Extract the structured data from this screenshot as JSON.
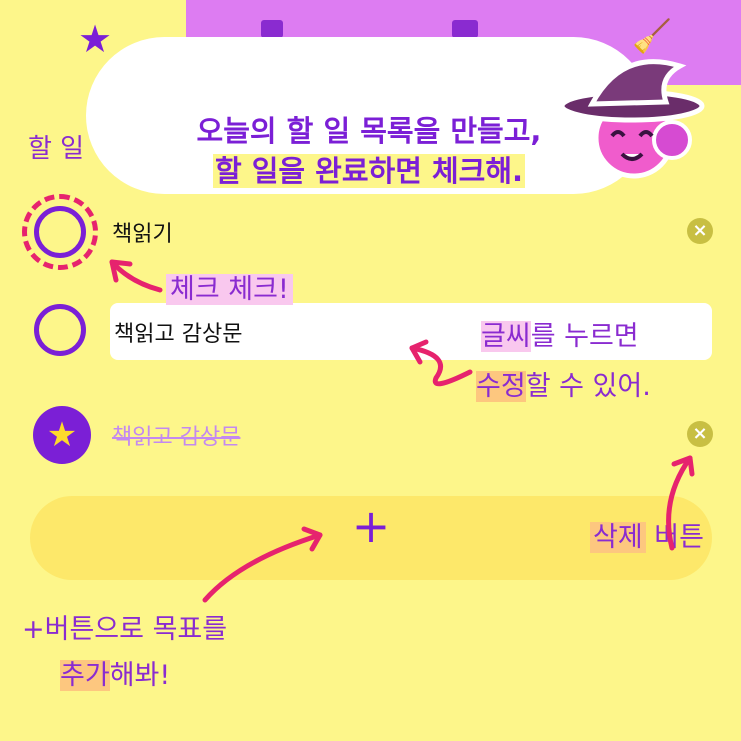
{
  "nav": {
    "icons": [
      "star-icon",
      "calendar-icon",
      "book-icon",
      "broom-icon"
    ],
    "colors": {
      "background": "#dd7cf2",
      "icon": "#8a2bd0"
    }
  },
  "header": {
    "title_partial": "할 일"
  },
  "bubble": {
    "line1": "오늘의 할 일 목록을 만들고,",
    "line2": "할 일을 완료하면 체크해."
  },
  "todos": [
    {
      "text": "책읽기",
      "done": false
    },
    {
      "text": "책읽고 감상문",
      "done": false
    },
    {
      "text": "책읽고 감상문",
      "done": true
    }
  ],
  "add": {
    "label": "+"
  },
  "annotations": {
    "check": "체크 체크!",
    "edit_line1_hl": "글씨",
    "edit_line1_rest": "를 누르면",
    "edit_line2_hl": "수정",
    "edit_line2_rest": "할 수 있어.",
    "delete_hl": "삭제",
    "delete_rest": " 버튼",
    "add_line1": "+버튼으로 목표를",
    "add_line2_hl": "추가",
    "add_line2_rest": "해봐!"
  },
  "colors": {
    "background": "#fdf68a",
    "accent": "#7b1fd6",
    "annotation_arrow": "#e6236e",
    "delete_button": "#c8bf43",
    "done_text": "#c389f0"
  }
}
